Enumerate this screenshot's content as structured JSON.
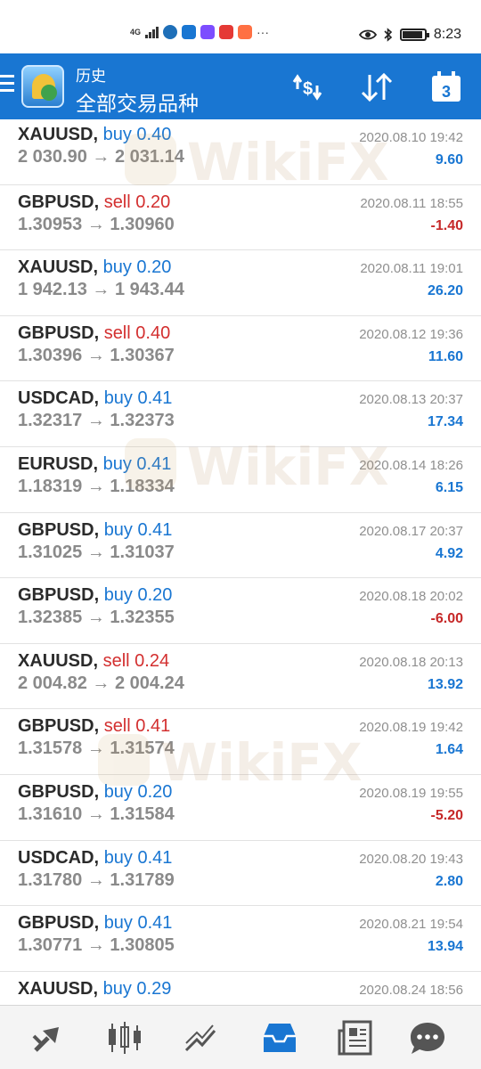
{
  "status_bar": {
    "signal_label": "4G",
    "time": "8:23",
    "more_dots": "···",
    "battery_level": 0.9
  },
  "header": {
    "title": "历史",
    "subtitle": "全部交易品种",
    "calendar_day": "3"
  },
  "trades": [
    {
      "symbol": "XAUUSD,",
      "side": "buy",
      "volume": "0.40",
      "open": "2 030.90",
      "close": "2 031.14",
      "time": "2020.08.10 19:42",
      "profit": "9.60"
    },
    {
      "symbol": "GBPUSD,",
      "side": "sell",
      "volume": "0.20",
      "open": "1.30953",
      "close": "1.30960",
      "time": "2020.08.11 18:55",
      "profit": "-1.40"
    },
    {
      "symbol": "XAUUSD,",
      "side": "buy",
      "volume": "0.20",
      "open": "1 942.13",
      "close": "1 943.44",
      "time": "2020.08.11 19:01",
      "profit": "26.20"
    },
    {
      "symbol": "GBPUSD,",
      "side": "sell",
      "volume": "0.40",
      "open": "1.30396",
      "close": "1.30367",
      "time": "2020.08.12 19:36",
      "profit": "11.60"
    },
    {
      "symbol": "USDCAD,",
      "side": "buy",
      "volume": "0.41",
      "open": "1.32317",
      "close": "1.32373",
      "time": "2020.08.13 20:37",
      "profit": "17.34"
    },
    {
      "symbol": "EURUSD,",
      "side": "buy",
      "volume": "0.41",
      "open": "1.18319",
      "close": "1.18334",
      "time": "2020.08.14 18:26",
      "profit": "6.15"
    },
    {
      "symbol": "GBPUSD,",
      "side": "buy",
      "volume": "0.41",
      "open": "1.31025",
      "close": "1.31037",
      "time": "2020.08.17 20:37",
      "profit": "4.92"
    },
    {
      "symbol": "GBPUSD,",
      "side": "buy",
      "volume": "0.20",
      "open": "1.32385",
      "close": "1.32355",
      "time": "2020.08.18 20:02",
      "profit": "-6.00"
    },
    {
      "symbol": "XAUUSD,",
      "side": "sell",
      "volume": "0.24",
      "open": "2 004.82",
      "close": "2 004.24",
      "time": "2020.08.18 20:13",
      "profit": "13.92"
    },
    {
      "symbol": "GBPUSD,",
      "side": "sell",
      "volume": "0.41",
      "open": "1.31578",
      "close": "1.31574",
      "time": "2020.08.19 19:42",
      "profit": "1.64"
    },
    {
      "symbol": "GBPUSD,",
      "side": "buy",
      "volume": "0.20",
      "open": "1.31610",
      "close": "1.31584",
      "time": "2020.08.19 19:55",
      "profit": "-5.20"
    },
    {
      "symbol": "USDCAD,",
      "side": "buy",
      "volume": "0.41",
      "open": "1.31780",
      "close": "1.31789",
      "time": "2020.08.20 19:43",
      "profit": "2.80"
    },
    {
      "symbol": "GBPUSD,",
      "side": "buy",
      "volume": "0.41",
      "open": "1.30771",
      "close": "1.30805",
      "time": "2020.08.21 19:54",
      "profit": "13.94"
    },
    {
      "symbol": "XAUUSD,",
      "side": "buy",
      "volume": "0.29",
      "open": "",
      "close": "",
      "time": "2020.08.24 18:56",
      "profit": ""
    }
  ],
  "watermark_text": "WikiFX",
  "arrow_glyph": "→",
  "colors": {
    "brand": "#1976d2",
    "buy": "#1976d2",
    "sell": "#d32f2f",
    "profit_positive": "#1976d2",
    "profit_negative": "#c62828"
  },
  "bottom_nav": [
    {
      "icon": "quotes-icon",
      "active": false
    },
    {
      "icon": "chart-icon",
      "active": false
    },
    {
      "icon": "trade-icon",
      "active": false
    },
    {
      "icon": "history-icon",
      "active": true
    },
    {
      "icon": "news-icon",
      "active": false
    },
    {
      "icon": "chat-icon",
      "active": false
    }
  ]
}
